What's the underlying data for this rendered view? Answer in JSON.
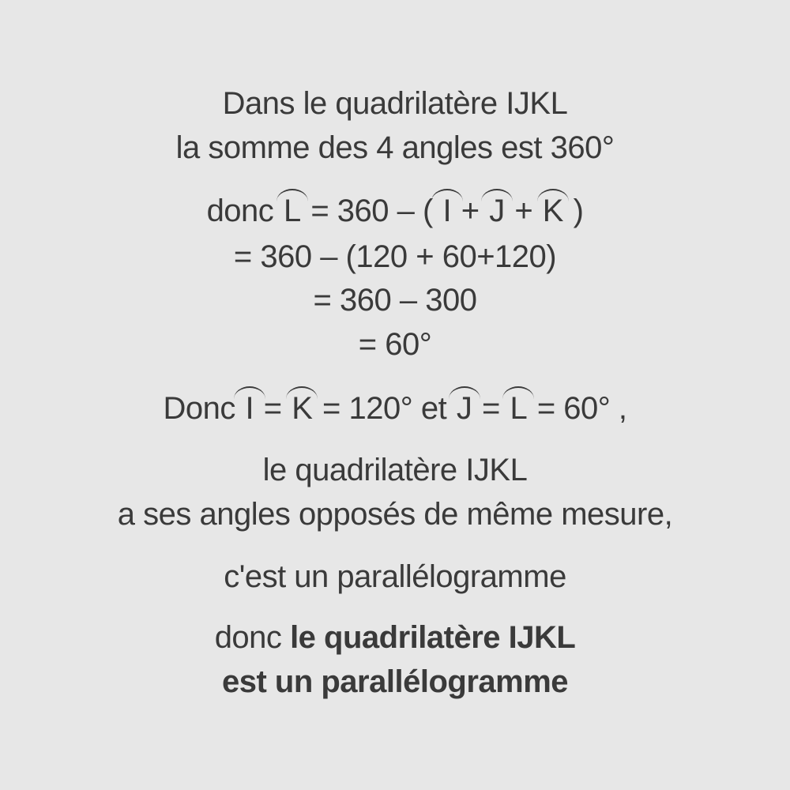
{
  "lines": {
    "l1": "Dans le quadrilatère IJKL",
    "l2": "la somme des 4 angles est 360°"
  },
  "formula": {
    "prefix": "donc",
    "angle_L": "L",
    "eq1": "= 360 – (",
    "angle_I": "I",
    "plus1": "+",
    "angle_J": "J",
    "plus2": "+",
    "angle_K": "K",
    "close": ")",
    "step2": "= 360 – (120 + 60+120)",
    "step3": "= 360 – 300",
    "step4": "= 60°"
  },
  "conclusion_angles": {
    "prefix": "Donc",
    "angle_I": "I",
    "eq1": "=",
    "angle_K": "K",
    "eq2": "= 120° et",
    "angle_J": "J",
    "eq3": "=",
    "angle_L": "L",
    "eq4": "= 60° ,"
  },
  "property": {
    "l1": "le quadrilatère IJKL",
    "l2": "a ses angles opposés de même mesure,",
    "l3": "c'est un parallélogramme"
  },
  "final": {
    "prefix": "donc",
    "bold1": "le quadrilatère IJKL",
    "bold2": "est un parallélogramme"
  }
}
